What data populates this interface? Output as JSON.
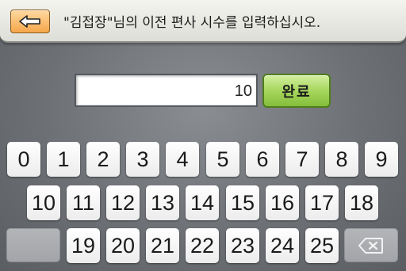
{
  "header": {
    "back_icon": "left-arrow-icon",
    "title": "\"김접장\"님의 이전 편사 시수를 입력하십시오."
  },
  "input": {
    "value": "10"
  },
  "done_button": {
    "label": "완료"
  },
  "keypad": {
    "row1": [
      "0",
      "1",
      "2",
      "3",
      "4",
      "5",
      "6",
      "7",
      "8",
      "9"
    ],
    "row2": [
      "10",
      "11",
      "12",
      "13",
      "14",
      "15",
      "16",
      "17",
      "18"
    ],
    "row3": [
      "19",
      "20",
      "21",
      "22",
      "23",
      "24",
      "25"
    ],
    "delete_icon": "backspace-icon"
  }
}
